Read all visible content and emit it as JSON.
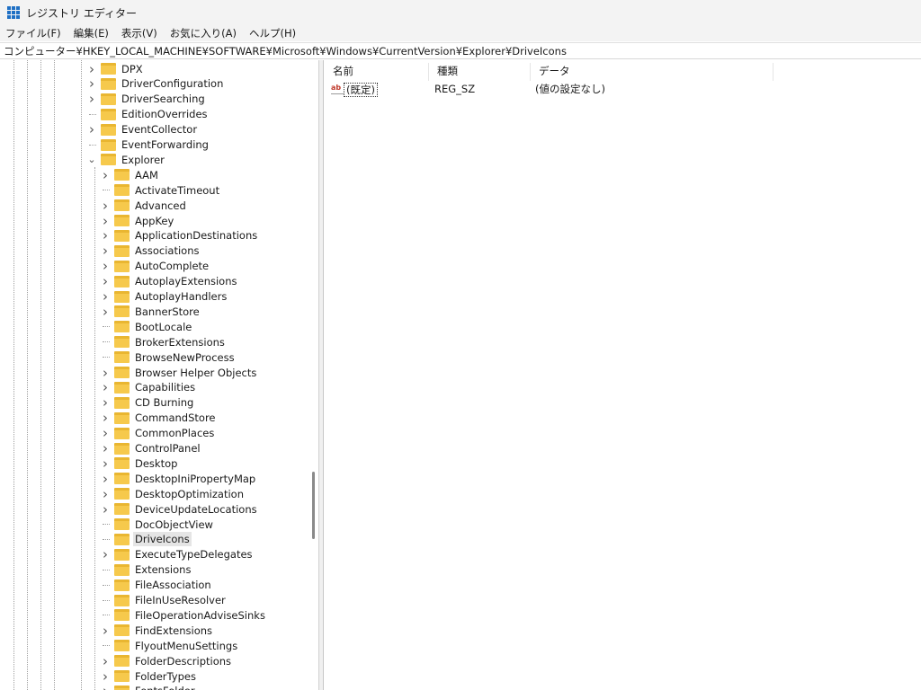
{
  "window": {
    "title": "レジストリ エディター"
  },
  "menu": [
    "ファイル(F)",
    "編集(E)",
    "表示(V)",
    "お気に入り(A)",
    "ヘルプ(H)"
  ],
  "address": "コンピューター¥HKEY_LOCAL_MACHINE¥SOFTWARE¥Microsoft¥Windows¥CurrentVersion¥Explorer¥DriveIcons",
  "tree": [
    {
      "label": "DPX",
      "level": 1,
      "expander": "collapsed"
    },
    {
      "label": "DriverConfiguration",
      "level": 1,
      "expander": "collapsed"
    },
    {
      "label": "DriverSearching",
      "level": 1,
      "expander": "collapsed"
    },
    {
      "label": "EditionOverrides",
      "level": 1,
      "expander": "none"
    },
    {
      "label": "EventCollector",
      "level": 1,
      "expander": "collapsed"
    },
    {
      "label": "EventForwarding",
      "level": 1,
      "expander": "none"
    },
    {
      "label": "Explorer",
      "level": 1,
      "expander": "expanded"
    },
    {
      "label": "AAM",
      "level": 2,
      "expander": "collapsed"
    },
    {
      "label": "ActivateTimeout",
      "level": 2,
      "expander": "none"
    },
    {
      "label": "Advanced",
      "level": 2,
      "expander": "collapsed"
    },
    {
      "label": "AppKey",
      "level": 2,
      "expander": "collapsed"
    },
    {
      "label": "ApplicationDestinations",
      "level": 2,
      "expander": "collapsed"
    },
    {
      "label": "Associations",
      "level": 2,
      "expander": "collapsed"
    },
    {
      "label": "AutoComplete",
      "level": 2,
      "expander": "collapsed"
    },
    {
      "label": "AutoplayExtensions",
      "level": 2,
      "expander": "collapsed"
    },
    {
      "label": "AutoplayHandlers",
      "level": 2,
      "expander": "collapsed"
    },
    {
      "label": "BannerStore",
      "level": 2,
      "expander": "collapsed"
    },
    {
      "label": "BootLocale",
      "level": 2,
      "expander": "none"
    },
    {
      "label": "BrokerExtensions",
      "level": 2,
      "expander": "none"
    },
    {
      "label": "BrowseNewProcess",
      "level": 2,
      "expander": "none"
    },
    {
      "label": "Browser Helper Objects",
      "level": 2,
      "expander": "collapsed"
    },
    {
      "label": "Capabilities",
      "level": 2,
      "expander": "collapsed"
    },
    {
      "label": "CD Burning",
      "level": 2,
      "expander": "collapsed"
    },
    {
      "label": "CommandStore",
      "level": 2,
      "expander": "collapsed"
    },
    {
      "label": "CommonPlaces",
      "level": 2,
      "expander": "collapsed"
    },
    {
      "label": "ControlPanel",
      "level": 2,
      "expander": "collapsed"
    },
    {
      "label": "Desktop",
      "level": 2,
      "expander": "collapsed"
    },
    {
      "label": "DesktopIniPropertyMap",
      "level": 2,
      "expander": "collapsed"
    },
    {
      "label": "DesktopOptimization",
      "level": 2,
      "expander": "collapsed"
    },
    {
      "label": "DeviceUpdateLocations",
      "level": 2,
      "expander": "collapsed"
    },
    {
      "label": "DocObjectView",
      "level": 2,
      "expander": "none"
    },
    {
      "label": "DriveIcons",
      "level": 2,
      "expander": "none",
      "selected": true
    },
    {
      "label": "ExecuteTypeDelegates",
      "level": 2,
      "expander": "collapsed"
    },
    {
      "label": "Extensions",
      "level": 2,
      "expander": "none"
    },
    {
      "label": "FileAssociation",
      "level": 2,
      "expander": "none"
    },
    {
      "label": "FileInUseResolver",
      "level": 2,
      "expander": "none"
    },
    {
      "label": "FileOperationAdviseSinks",
      "level": 2,
      "expander": "none"
    },
    {
      "label": "FindExtensions",
      "level": 2,
      "expander": "collapsed"
    },
    {
      "label": "FlyoutMenuSettings",
      "level": 2,
      "expander": "none"
    },
    {
      "label": "FolderDescriptions",
      "level": 2,
      "expander": "collapsed"
    },
    {
      "label": "FolderTypes",
      "level": 2,
      "expander": "collapsed"
    },
    {
      "label": "FontsFolder",
      "level": 2,
      "expander": "collapsed"
    }
  ],
  "list": {
    "headers": [
      "名前",
      "種類",
      "データ"
    ],
    "rows": [
      {
        "icon": "ab",
        "name": "(既定)",
        "type": "REG_SZ",
        "data": "(値の設定なし)"
      }
    ]
  }
}
